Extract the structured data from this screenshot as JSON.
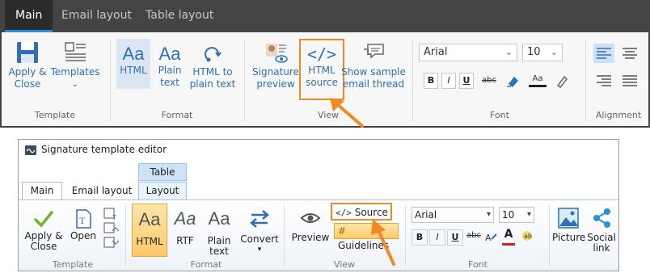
{
  "top": {
    "tabs": [
      {
        "label": "Main",
        "active": true
      },
      {
        "label": "Email layout",
        "active": false
      },
      {
        "label": "Table layout",
        "active": false
      }
    ],
    "groups": {
      "template": "Template",
      "format": "Format",
      "view": "View",
      "font": "Font",
      "alignment": "Alignment"
    },
    "buttons": {
      "apply_close_1": "Apply &",
      "apply_close_2": "Close",
      "templates": "Templates",
      "templates_chevron": "⌄",
      "html": "HTML",
      "plain_text_1": "Plain",
      "plain_text_2": "text",
      "html_to_plain_1": "HTML to",
      "html_to_plain_2": "plain text",
      "sig_preview_1": "Signature",
      "sig_preview_2": "preview",
      "html_source_1": "HTML",
      "html_source_2": "source",
      "show_sample_1": "Show sample",
      "show_sample_2": "email thread"
    },
    "font": {
      "family": "Arial",
      "size": "10",
      "bold": "B",
      "italic": "I",
      "underline": "U",
      "strike": "abc",
      "clear_format_label": "Aa"
    },
    "accent_color": "#2a8ee0",
    "highlight_color": "#f08a24"
  },
  "bottom": {
    "title": "Signature template editor",
    "context_tab": "Table",
    "tabs": [
      {
        "label": "Main",
        "active": true
      },
      {
        "label": "Email layout",
        "active": false
      },
      {
        "label": "Layout",
        "active": false
      }
    ],
    "groups": {
      "template": "Template",
      "format": "Format",
      "view": "View",
      "font": "Font",
      "insert_label": "Picture"
    },
    "buttons": {
      "apply_close_1": "Apply &",
      "apply_close_2": "Close",
      "open": "Open",
      "html": "HTML",
      "rtf": "RTF",
      "plain_text_1": "Plain",
      "plain_text_2": "text",
      "convert": "Convert",
      "convert_chevron": "▾",
      "preview": "Preview",
      "source": "Source",
      "guidelines": "Guidelines",
      "picture": "Picture",
      "social_link_1": "Social",
      "social_link_2": "link"
    },
    "font": {
      "family": "Arial",
      "size": "10",
      "bold": "B",
      "italic": "I",
      "underline": "U",
      "strike": "abc",
      "font_color": "A"
    },
    "highlight_color": "#f08a24",
    "selected_color": "#ffc96b"
  }
}
